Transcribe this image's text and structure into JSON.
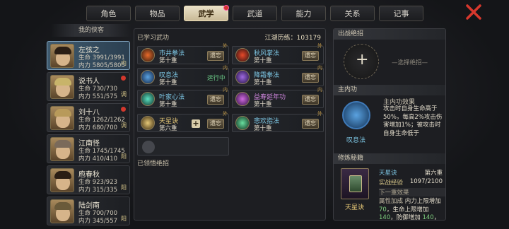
{
  "tabs": [
    {
      "label": "角色",
      "active": false
    },
    {
      "label": "物品",
      "active": false
    },
    {
      "label": "武学",
      "active": true,
      "badge": true
    },
    {
      "label": "武道",
      "active": false
    },
    {
      "label": "能力",
      "active": false
    },
    {
      "label": "关系",
      "active": false
    },
    {
      "label": "记事",
      "active": false
    }
  ],
  "left": {
    "title": "我的侠客"
  },
  "characters": [
    {
      "name": "左弦之",
      "hp": "生命 3991/3991",
      "mp": "内力 5805/5805",
      "tag": "内",
      "selected": true,
      "dot": false
    },
    {
      "name": "说书人",
      "hp": "生命 730/730",
      "mp": "内力 551/575",
      "tag": "调",
      "selected": false,
      "dot": true
    },
    {
      "name": "刘十八",
      "hp": "生命 1262/1262",
      "mp": "内力 680/700",
      "tag": "调",
      "selected": false,
      "dot": true
    },
    {
      "name": "江南怪",
      "hp": "生命 1745/1745",
      "mp": "内力 410/410",
      "tag": "阳",
      "selected": false,
      "dot": false
    },
    {
      "name": "庖春秋",
      "hp": "生命 923/923",
      "mp": "内力 315/335",
      "tag": "阳",
      "selected": false,
      "dot": false
    },
    {
      "name": "陆剑南",
      "hp": "生命 700/700",
      "mp": "内力 345/557",
      "tag": "阳",
      "selected": false,
      "dot": false
    }
  ],
  "middle": {
    "header": "已学习武功",
    "experience": "江湖历练：103179",
    "footer": "已领悟绝招",
    "skills": [
      {
        "name": "市井拳法",
        "level": "第十重",
        "action": "遗忘",
        "type": "外",
        "color": "#7ec8e6"
      },
      {
        "name": "秋风掌法",
        "level": "第十重",
        "action": "遗忘",
        "type": "外",
        "color": "#7ec8e6"
      },
      {
        "name": "叹息法",
        "level": "第十重",
        "action": "运行中",
        "type": "内",
        "color": "#7ec8e6"
      },
      {
        "name": "降霜拳法",
        "level": "第十重",
        "action": "遗忘",
        "type": "内",
        "color": "#7ec8e6"
      },
      {
        "name": "叶家心法",
        "level": "第十重",
        "action": "遗忘",
        "type": "内",
        "color": "#7ec8e6"
      },
      {
        "name": "益寿延年功",
        "level": "第十重",
        "action": "遗忘",
        "type": "内",
        "color": "#d88ae6"
      },
      {
        "name": "天星诀",
        "level": "第六重",
        "action": "遗忘",
        "type": "外",
        "color": "#e6c877"
      },
      {
        "name": "悲欢指法",
        "level": "第十重",
        "action": "遗忘",
        "type": "外",
        "color": "#7ec8e6"
      }
    ]
  },
  "right": {
    "ultimate": {
      "title": "出战绝招",
      "hint": "选择绝招"
    },
    "inner": {
      "title": "主内功",
      "skill": "叹息法",
      "effect_title": "主内功效果",
      "effect": "攻击时自身生命高于50%，每高2%攻击伤害增加1%；被攻击时自身生命低于"
    },
    "book": {
      "title": "修炼秘籍",
      "name": "天星诀",
      "level": "第六重",
      "exp_label": "实战经验",
      "exp_value": "1097/2100",
      "next": "下一重效果",
      "attr_label": "属性加成",
      "attr_1": "内力上限增加",
      "val_1": "70",
      "attr_2": "生命上限增加",
      "val_2": "140",
      "attr_3": "防御增加",
      "val_3": "140"
    }
  }
}
